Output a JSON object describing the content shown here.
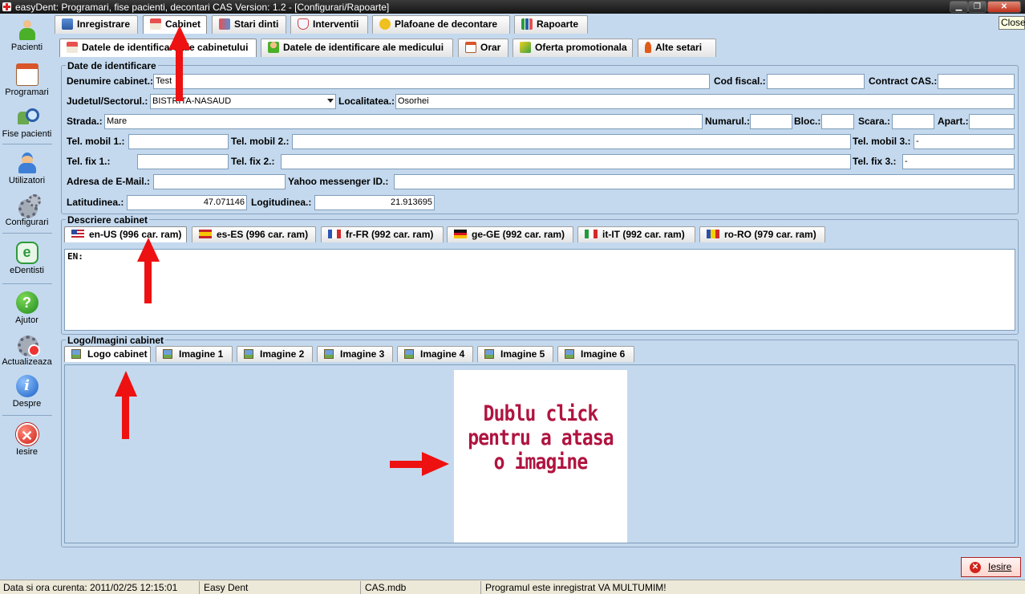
{
  "window": {
    "title": "easyDent: Programari,  fise pacienti, decontari CAS   Version: 1.2 - [Configurari/Rapoarte]",
    "close_tooltip": "Close"
  },
  "sidebar": {
    "items": [
      {
        "label": "Pacienti",
        "icon": "patient-icon"
      },
      {
        "label": "Programari",
        "icon": "calendar-icon"
      },
      {
        "label": "Fise pacienti",
        "icon": "patient-search-icon"
      },
      {
        "label": "Utilizatori",
        "icon": "doctor-icon"
      },
      {
        "label": "Configurari",
        "icon": "gears-icon"
      },
      {
        "label": "eDentisti",
        "icon": "edentisti-icon"
      },
      {
        "label": "Ajutor",
        "icon": "help-icon"
      },
      {
        "label": "Actualizeaza",
        "icon": "update-icon"
      },
      {
        "label": "Despre",
        "icon": "info-icon"
      },
      {
        "label": "Iesire",
        "icon": "exit-icon"
      }
    ]
  },
  "main_tabs": [
    {
      "label": "Inregistrare"
    },
    {
      "label": "Cabinet"
    },
    {
      "label": "Stari dinti"
    },
    {
      "label": "Interventii"
    },
    {
      "label": "Plafoane de decontare"
    },
    {
      "label": "Rapoarte"
    }
  ],
  "sub_tabs": [
    {
      "label": "Datele de identificare ale cabinetului"
    },
    {
      "label": "Datele de identificare ale medicului"
    },
    {
      "label": "Orar"
    },
    {
      "label": "Oferta promotionala"
    },
    {
      "label": "Alte setari"
    }
  ],
  "identification": {
    "group_title": "Date de identificare",
    "denumire_label": "Denumire cabinet.:",
    "denumire_value": "Test",
    "cod_fiscal_label": "Cod fiscal.:",
    "cod_fiscal_value": "",
    "contract_label": "Contract CAS.:",
    "contract_value": "",
    "judet_label": "Judetul/Sectorul.:",
    "judet_value": "BISTRITA-NASAUD",
    "localitate_label": "Localitatea.:",
    "localitate_value": "Osorhei",
    "strada_label": "Strada.:",
    "strada_value": "Mare",
    "numar_label": "Numarul.:",
    "bloc_label": "Bloc.:",
    "scara_label": "Scara.:",
    "apart_label": "Apart.:",
    "mobil1_label": "Tel. mobil 1.:",
    "mobil2_label": "Tel. mobil 2.:",
    "mobil3_label": "Tel. mobil 3.:",
    "mobil3_value": "-",
    "fix1_label": "Tel. fix 1.:",
    "fix2_label": "Tel. fix 2.:",
    "fix3_label": "Tel. fix 3.:",
    "fix3_value": "-",
    "email_label": "Adresa de E-Mail.:",
    "yahoo_label": "Yahoo messenger ID.:",
    "lat_label": "Latitudinea.:",
    "lat_value": "47.071146",
    "long_label": "Logitudinea.:",
    "long_value": "21.913695"
  },
  "description": {
    "group_title": "Descriere cabinet",
    "tabs": [
      {
        "label": "en-US (996 car. ram)",
        "flag": "us"
      },
      {
        "label": "es-ES (996 car. ram)",
        "flag": "es"
      },
      {
        "label": "fr-FR (992 car. ram)",
        "flag": "fr"
      },
      {
        "label": "ge-GE (992 car. ram)",
        "flag": "de"
      },
      {
        "label": "it-IT (992 car. ram)",
        "flag": "it"
      },
      {
        "label": "ro-RO (979 car. ram)",
        "flag": "ro"
      }
    ],
    "text": "EN:"
  },
  "images": {
    "group_title": "Logo/Imagini cabinet",
    "tabs": [
      {
        "label": "Logo cabinet"
      },
      {
        "label": "Imagine 1"
      },
      {
        "label": "Imagine 2"
      },
      {
        "label": "Imagine 3"
      },
      {
        "label": "Imagine 4"
      },
      {
        "label": "Imagine 5"
      },
      {
        "label": "Imagine 6"
      }
    ],
    "placeholder_line1": "Dublu click",
    "placeholder_line2": "pentru a atasa",
    "placeholder_line3": "o imagine"
  },
  "exit_button": {
    "label": "Iesire"
  },
  "statusbar": {
    "datetime": "Data si ora curenta: 2011/02/25 12:15:01",
    "app": "Easy Dent",
    "db": "CAS.mdb",
    "message": "Programul este inregistrat VA MULTUMIM!"
  },
  "colors": {
    "background": "#c4d9ee",
    "annotation_arrow": "#ee1111",
    "placeholder_text": "#b0133f"
  }
}
